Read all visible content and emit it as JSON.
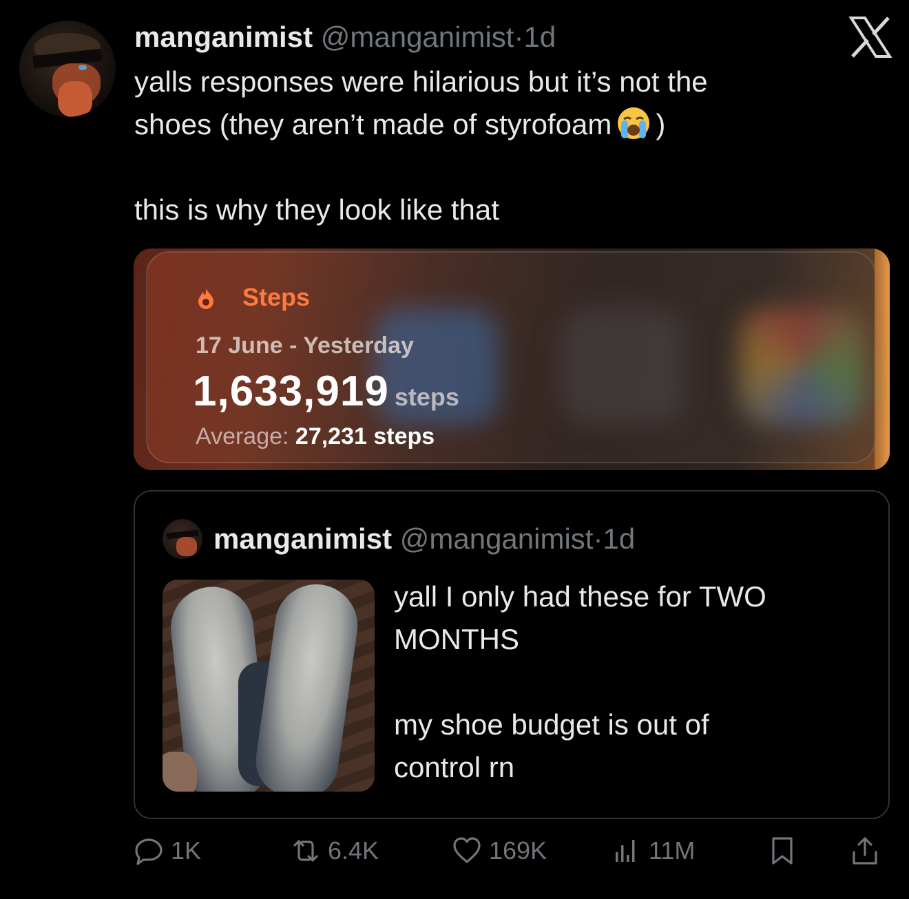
{
  "tweet": {
    "author_name": "manganimist",
    "author_handle": "@manganimist",
    "separator": "·",
    "time": "1d",
    "text_line1": "yalls responses were hilarious but it’s not the",
    "text_line2_a": "shoes (they aren’t made of styrofoam",
    "text_line2_b": ")",
    "text_line3": "this is why they look like that",
    "emoji": "loudly-crying-face-emoji"
  },
  "steps_card": {
    "title": "Steps",
    "range": "17 June - Yesterday",
    "total": "1,633,919",
    "unit": "steps",
    "average_label": "Average:",
    "average_value": "27,231 steps",
    "accent_color": "#ff7a3d"
  },
  "quoted_tweet": {
    "author_name": "manganimist",
    "author_handle": "@manganimist",
    "separator": "·",
    "time": "1d",
    "text_line1": "yall I only had these for TWO",
    "text_line2": "MONTHS",
    "text_line3": "my shoe budget is out of",
    "text_line4": "control rn"
  },
  "actions": {
    "replies": "1K",
    "reposts": "6.4K",
    "likes": "169K",
    "views": "11M"
  },
  "icons": [
    "x-logo-icon",
    "flame-icon",
    "reply-icon",
    "repost-icon",
    "heart-icon",
    "views-icon",
    "bookmark-icon",
    "share-icon"
  ],
  "colors": {
    "background": "#000000",
    "text": "#e7e9ea",
    "secondary_text": "#71767b",
    "border": "#2f3336"
  }
}
